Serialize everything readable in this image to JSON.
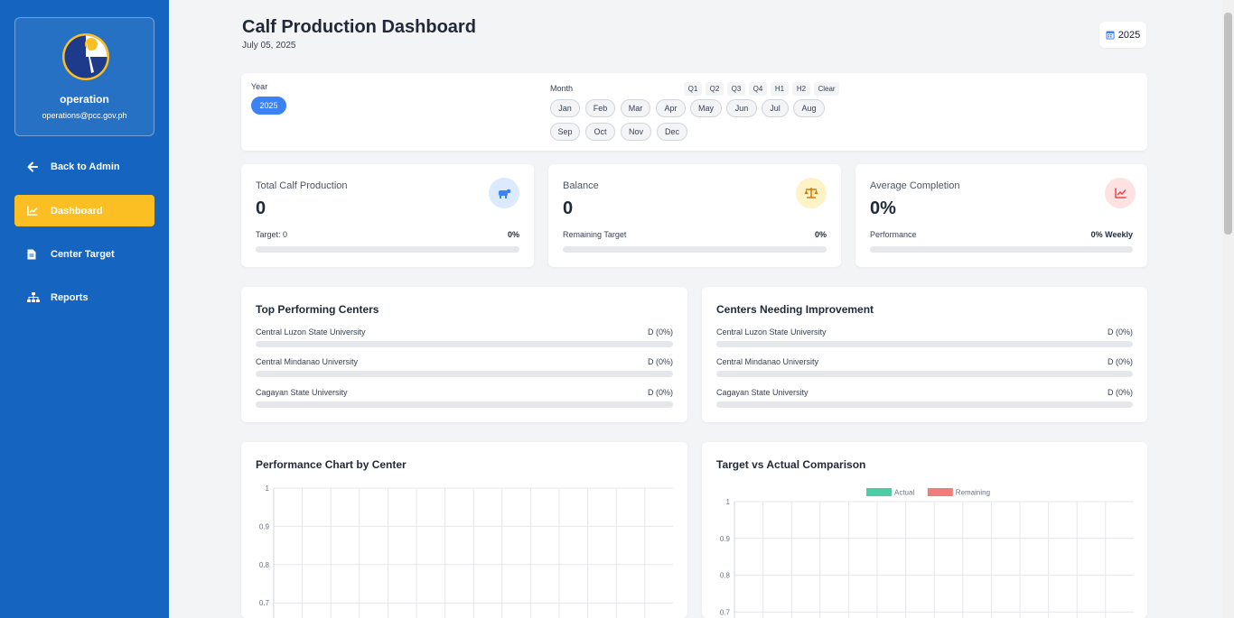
{
  "sidebar": {
    "user_name": "operation",
    "user_email": "operations@pcc.gov.ph",
    "items": [
      {
        "label": "Back to Admin",
        "icon": "arrow-left-icon"
      },
      {
        "label": "Dashboard",
        "icon": "chart-line-icon",
        "active": true
      },
      {
        "label": "Center Target",
        "icon": "file-icon"
      },
      {
        "label": "Reports",
        "icon": "sitemap-icon"
      }
    ],
    "active_color": "#fbbf24",
    "background": "#1565c0"
  },
  "header": {
    "title": "Calf Production Dashboard",
    "date": "July 05, 2025",
    "year_button": "2025"
  },
  "filters": {
    "year_label": "Year",
    "year_selected": "2025",
    "month_label": "Month",
    "quick": [
      "Q1",
      "Q2",
      "Q3",
      "Q4",
      "H1",
      "H2",
      "Clear"
    ],
    "months_row1": [
      "Jan",
      "Feb",
      "Mar",
      "Apr",
      "May",
      "Jun",
      "Jul",
      "Aug"
    ],
    "months_row2": [
      "Sep",
      "Oct",
      "Nov",
      "Dec"
    ]
  },
  "stats": [
    {
      "label": "Total Calf Production",
      "value": "0",
      "sub": "Target: 0",
      "pct": "0%",
      "icon": "cow-icon",
      "color": "#3b82f6"
    },
    {
      "label": "Balance",
      "value": "0",
      "sub": "Remaining Target",
      "pct": "0%",
      "icon": "balance-scale-icon",
      "color": "#d97706"
    },
    {
      "label": "Average Completion",
      "value": "0%",
      "sub": "Performance",
      "pct": "0% Weekly",
      "icon": "chart-line-icon",
      "color": "#ef4444"
    }
  ],
  "top_centers": {
    "title": "Top Performing Centers",
    "rows": [
      {
        "name": "Central Luzon State University",
        "value": "D (0%)"
      },
      {
        "name": "Central Mindanao University",
        "value": "D (0%)"
      },
      {
        "name": "Cagayan State University",
        "value": "D (0%)"
      }
    ]
  },
  "improve_centers": {
    "title": "Centers Needing Improvement",
    "rows": [
      {
        "name": "Central Luzon State University",
        "value": "D (0%)"
      },
      {
        "name": "Central Mindanao University",
        "value": "D (0%)"
      },
      {
        "name": "Cagayan State University",
        "value": "D (0%)"
      }
    ]
  },
  "charts": {
    "performance_title": "Performance Chart by Center",
    "comparison_title": "Target vs Actual Comparison"
  },
  "chart_data": [
    {
      "type": "bar",
      "title": "Performance Chart by Center",
      "y_ticks": [
        "1",
        "0.9",
        "0.8",
        "0.7"
      ],
      "ylim": [
        0,
        1
      ],
      "grid": true,
      "series": []
    },
    {
      "type": "bar",
      "title": "Target vs Actual Comparison",
      "legend": [
        {
          "name": "Actual",
          "color": "#4ecca3"
        },
        {
          "name": "Remaining",
          "color": "#f07c7c"
        }
      ],
      "legend_placement": "top",
      "y_ticks": [
        "1",
        "0.9",
        "0.8",
        "0.7"
      ],
      "ylim": [
        0,
        1
      ],
      "grid": true,
      "series": [
        {
          "name": "Actual",
          "values": []
        },
        {
          "name": "Remaining",
          "values": []
        }
      ]
    }
  ]
}
